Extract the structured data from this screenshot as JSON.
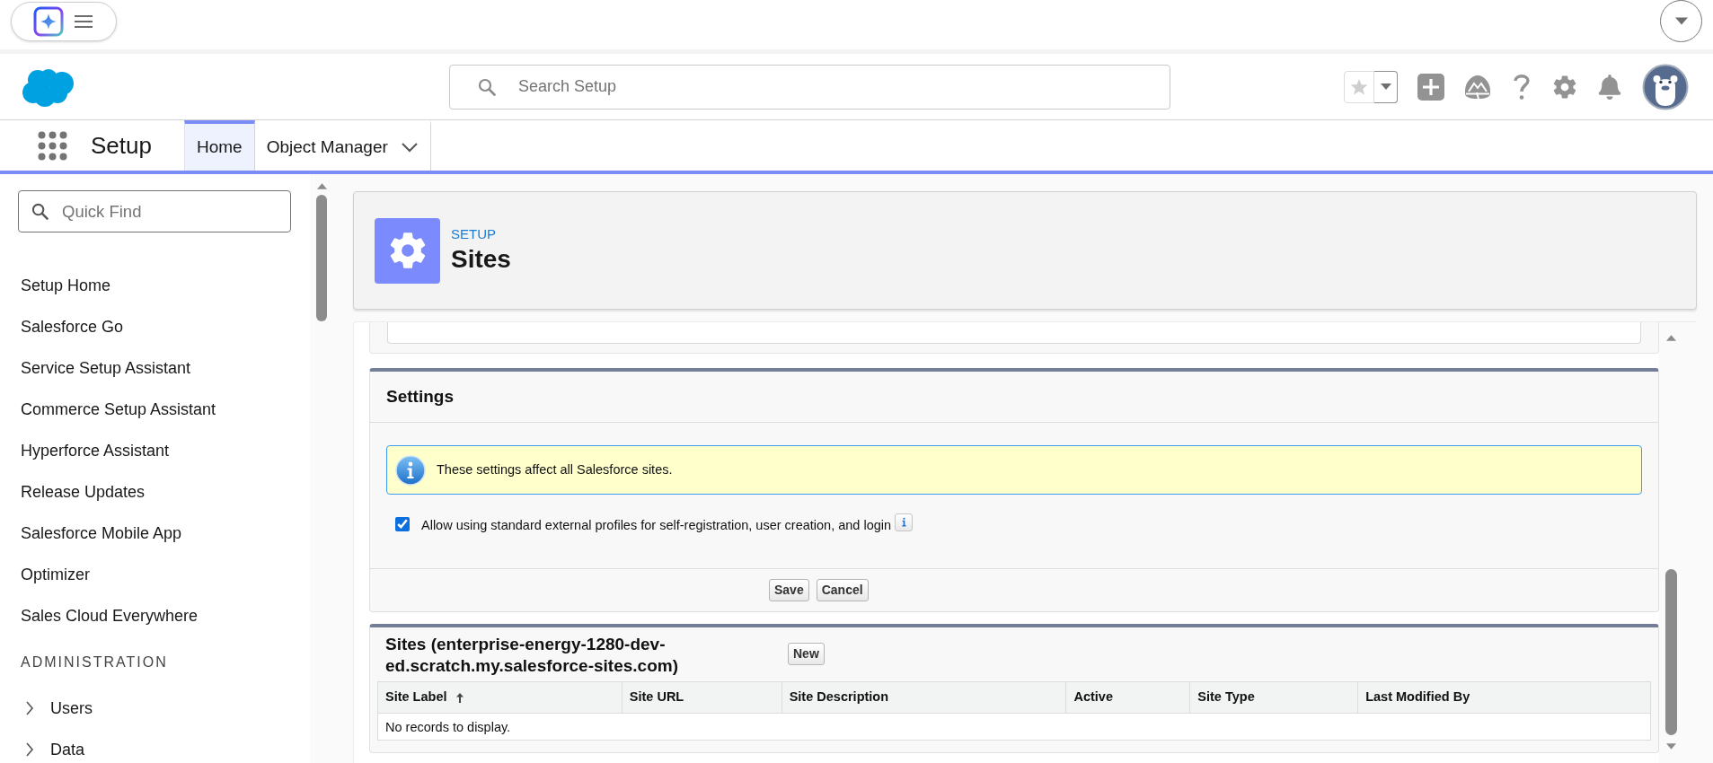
{
  "header": {
    "search": {
      "placeholder": "Search Setup"
    }
  },
  "nav": {
    "app_name": "Setup",
    "tabs": [
      {
        "label": "Home",
        "selected": true,
        "kind": "plain"
      },
      {
        "label": "Object Manager",
        "selected": false,
        "kind": "menu"
      }
    ]
  },
  "sidebar": {
    "quick_find": {
      "placeholder": "Quick Find"
    },
    "items": [
      {
        "label": "Setup Home"
      },
      {
        "label": "Salesforce Go"
      },
      {
        "label": "Service Setup Assistant"
      },
      {
        "label": "Commerce Setup Assistant"
      },
      {
        "label": "Hyperforce Assistant"
      },
      {
        "label": "Release Updates"
      },
      {
        "label": "Salesforce Mobile App"
      },
      {
        "label": "Optimizer"
      },
      {
        "label": "Sales Cloud Everywhere"
      }
    ],
    "sections": [
      {
        "heading": "ADMINISTRATION",
        "items": [
          {
            "label": "Users",
            "expanded": false
          },
          {
            "label": "Data",
            "expanded": false
          }
        ]
      }
    ]
  },
  "page_header": {
    "eyebrow": "SETUP",
    "title": "Sites"
  },
  "settings": {
    "title": "Settings",
    "info_message": "These settings affect all Salesforce sites.",
    "options": [
      {
        "label": "Allow using standard external profiles for self-registration, user creation, and login",
        "checked": true,
        "has_help": true
      }
    ],
    "buttons": [
      "Save",
      "Cancel"
    ]
  },
  "sites": {
    "title": "Sites (enterprise-energy-1280-dev-ed.scratch.my.salesforce-sites.com)",
    "buttons": [
      "New"
    ],
    "table": {
      "columns": [
        {
          "label": "Site Label",
          "sorted": true
        },
        {
          "label": "Site URL",
          "sorted": false
        },
        {
          "label": "Site Description",
          "sorted": false
        },
        {
          "label": "Active",
          "sorted": false
        },
        {
          "label": "Site Type",
          "sorted": false
        },
        {
          "label": "Last Modified By",
          "sorted": false
        }
      ],
      "empty_message": "No records to display."
    }
  }
}
